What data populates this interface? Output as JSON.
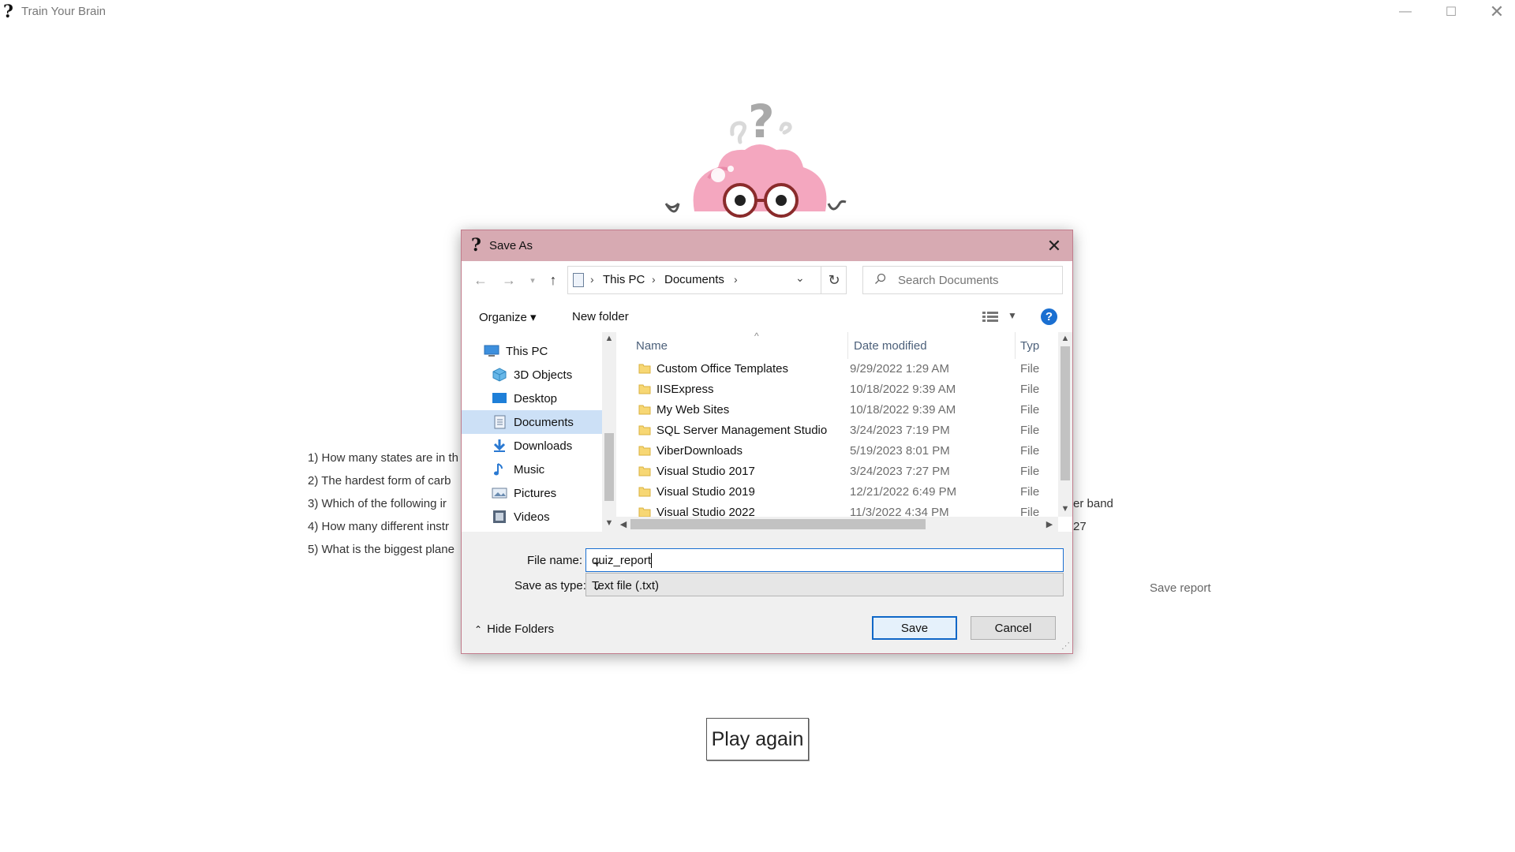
{
  "app": {
    "title": "Train Your Brain",
    "title_icon": "?",
    "min_glyph": "—",
    "max_glyph": "☐",
    "close_glyph": "✕"
  },
  "quiz": {
    "questions": [
      "1) How many states are in th",
      "2) The hardest form of carb",
      "3) Which of the following ir",
      "4) How many different instr",
      "5) What is the biggest plane"
    ],
    "right_fragments": [
      "er band",
      "27"
    ],
    "save_report_label": "Save report",
    "play_again_label": "Play again"
  },
  "dialog": {
    "title": "Save As",
    "title_icon": "?",
    "close_glyph": "✕",
    "breadcrumb": [
      "This PC",
      "Documents"
    ],
    "search_placeholder": "Search Documents",
    "organize_label": "Organize ▾",
    "new_folder_label": "New folder",
    "help_label": "?",
    "nav_items": [
      {
        "label": "This PC",
        "icon": "computer-icon"
      },
      {
        "label": "3D Objects",
        "icon": "cube-icon"
      },
      {
        "label": "Desktop",
        "icon": "desktop-icon"
      },
      {
        "label": "Documents",
        "icon": "documents-icon",
        "selected": true
      },
      {
        "label": "Downloads",
        "icon": "download-icon"
      },
      {
        "label": "Music",
        "icon": "music-icon"
      },
      {
        "label": "Pictures",
        "icon": "pictures-icon"
      },
      {
        "label": "Videos",
        "icon": "videos-icon"
      }
    ],
    "columns": {
      "name": "Name",
      "date": "Date modified",
      "type": "Typ"
    },
    "files": [
      {
        "name": "Custom Office Templates",
        "date": "9/29/2022 1:29 AM",
        "type": "File"
      },
      {
        "name": "IISExpress",
        "date": "10/18/2022 9:39 AM",
        "type": "File"
      },
      {
        "name": "My Web Sites",
        "date": "10/18/2022 9:39 AM",
        "type": "File"
      },
      {
        "name": "SQL Server Management Studio",
        "date": "3/24/2023 7:19 PM",
        "type": "File"
      },
      {
        "name": "ViberDownloads",
        "date": "5/19/2023 8:01 PM",
        "type": "File"
      },
      {
        "name": "Visual Studio 2017",
        "date": "3/24/2023 7:27 PM",
        "type": "File"
      },
      {
        "name": "Visual Studio 2019",
        "date": "12/21/2022 6:49 PM",
        "type": "File"
      },
      {
        "name": "Visual Studio 2022",
        "date": "11/3/2022 4:34 PM",
        "type": "File"
      }
    ],
    "file_name_label": "File name:",
    "file_name_value": "quiz_report",
    "save_type_label": "Save as type:",
    "save_type_value": "Text file (.txt)",
    "hide_folders_label": "Hide Folders",
    "save_label": "Save",
    "cancel_label": "Cancel"
  },
  "colors": {
    "dialog_titlebar": "#d7aab2",
    "accent_blue": "#1a6fd1",
    "selected_nav": "#cce0f6",
    "folder_yellow": "#f7d774"
  }
}
